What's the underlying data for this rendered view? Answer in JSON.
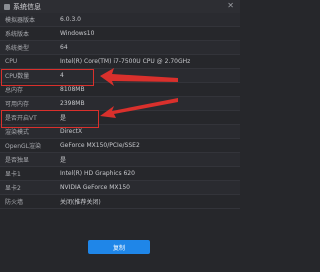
{
  "window": {
    "title": "系统信息",
    "close_glyph": "✕"
  },
  "rows": [
    {
      "label": "模拟器版本",
      "value": "6.0.3.0"
    },
    {
      "label": "系统版本",
      "value": "Windows10"
    },
    {
      "label": "系统类型",
      "value": "64"
    },
    {
      "label": "CPU",
      "value": "Intel(R) Core(TM) i7-7500U CPU @ 2.70GHz"
    },
    {
      "label": "CPU数量",
      "value": "4"
    },
    {
      "label": "总内存",
      "value": "8108MB"
    },
    {
      "label": "可用内存",
      "value": "2398MB"
    },
    {
      "label": "是否开启VT",
      "value": "是"
    },
    {
      "label": "渲染模式",
      "value": "DirectX"
    },
    {
      "label": "OpenGL渲染",
      "value": "GeForce MX150/PCIe/SSE2"
    },
    {
      "label": "是否独显",
      "value": "是"
    },
    {
      "label": "显卡1",
      "value": "Intel(R) HD Graphics 620"
    },
    {
      "label": "显卡2",
      "value": "NVIDIA GeForce MX150"
    },
    {
      "label": "防火墙",
      "value": "关闭(推荐关闭)"
    }
  ],
  "buttons": {
    "copy_label": "复制"
  },
  "colors": {
    "highlight": "#d9302c",
    "accent": "#1f86e8",
    "background": "#26272b"
  },
  "icons": {
    "title": "app-icon",
    "close": "close-icon"
  }
}
